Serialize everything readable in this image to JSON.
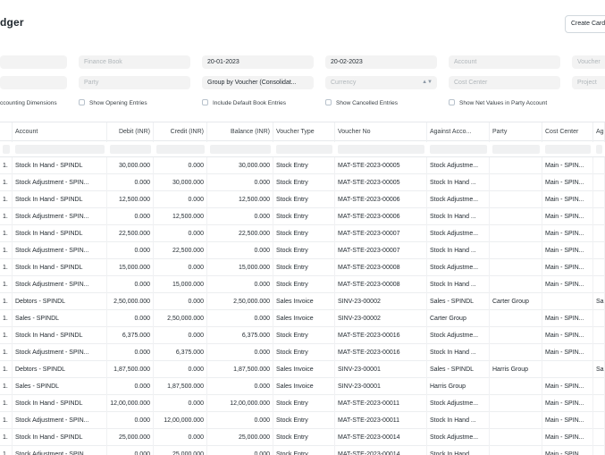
{
  "header": {
    "title": "dger",
    "create_button": "Create Card"
  },
  "filters": {
    "row1": {
      "f0": "",
      "finance_book": "Finance Book",
      "from_date": "20-01-2023",
      "to_date": "20-02-2023",
      "account": "Account",
      "voucher": "Voucher"
    },
    "row2": {
      "f0": "",
      "party": "Party",
      "group_by": "Group by Voucher (Consolidat...",
      "currency": "Currency",
      "cost_center": "Cost Center",
      "project": "Project"
    }
  },
  "checkboxes": {
    "accounting_dimensions": "ccounting Dimensions",
    "opening_entries": "Show Opening Entries",
    "default_book": "Include Default Book Entries",
    "cancelled": "Show Cancelled Entries",
    "net_values": "Show Net Values in Party Account"
  },
  "table": {
    "headers": [
      "",
      "Account",
      "Debit (INR)",
      "Credit (INR)",
      "Balance (INR)",
      "Voucher Type",
      "Voucher No",
      "Against Acco...",
      "Party",
      "Cost Center",
      "Ag"
    ],
    "rows": [
      [
        "1.",
        "Stock In Hand - SPINDL",
        "30,000.000",
        "0.000",
        "30,000.000",
        "Stock Entry",
        "MAT-STE-2023-00005",
        "Stock Adjustme...",
        "",
        "Main - SPIN...",
        ""
      ],
      [
        "1.",
        "Stock Adjustment - SPIN...",
        "0.000",
        "30,000.000",
        "0.000",
        "Stock Entry",
        "MAT-STE-2023-00005",
        "Stock In Hand ...",
        "",
        "Main - SPIN...",
        ""
      ],
      [
        "1.",
        "Stock In Hand - SPINDL",
        "12,500.000",
        "0.000",
        "12,500.000",
        "Stock Entry",
        "MAT-STE-2023-00006",
        "Stock Adjustme...",
        "",
        "Main - SPIN...",
        ""
      ],
      [
        "1.",
        "Stock Adjustment - SPIN...",
        "0.000",
        "12,500.000",
        "0.000",
        "Stock Entry",
        "MAT-STE-2023-00006",
        "Stock In Hand ...",
        "",
        "Main - SPIN...",
        ""
      ],
      [
        "1.",
        "Stock In Hand - SPINDL",
        "22,500.000",
        "0.000",
        "22,500.000",
        "Stock Entry",
        "MAT-STE-2023-00007",
        "Stock Adjustme...",
        "",
        "Main - SPIN...",
        ""
      ],
      [
        "1.",
        "Stock Adjustment - SPIN...",
        "0.000",
        "22,500.000",
        "0.000",
        "Stock Entry",
        "MAT-STE-2023-00007",
        "Stock In Hand ...",
        "",
        "Main - SPIN...",
        ""
      ],
      [
        "1.",
        "Stock In Hand - SPINDL",
        "15,000.000",
        "0.000",
        "15,000.000",
        "Stock Entry",
        "MAT-STE-2023-00008",
        "Stock Adjustme...",
        "",
        "Main - SPIN...",
        ""
      ],
      [
        "1.",
        "Stock Adjustment - SPIN...",
        "0.000",
        "15,000.000",
        "0.000",
        "Stock Entry",
        "MAT-STE-2023-00008",
        "Stock In Hand ...",
        "",
        "Main - SPIN...",
        ""
      ],
      [
        "1.",
        "Debtors - SPINDL",
        "2,50,000.000",
        "0.000",
        "2,50,000.000",
        "Sales Invoice",
        "SINV-23-00002",
        "Sales - SPINDL",
        "Carter Group",
        "",
        "Sa"
      ],
      [
        "1.",
        "Sales - SPINDL",
        "0.000",
        "2,50,000.000",
        "0.000",
        "Sales Invoice",
        "SINV-23-00002",
        "Carter Group",
        "",
        "Main - SPIN...",
        ""
      ],
      [
        "1.",
        "Stock In Hand - SPINDL",
        "6,375.000",
        "0.000",
        "6,375.000",
        "Stock Entry",
        "MAT-STE-2023-00016",
        "Stock Adjustme...",
        "",
        "Main - SPIN...",
        ""
      ],
      [
        "1.",
        "Stock Adjustment - SPIN...",
        "0.000",
        "6,375.000",
        "0.000",
        "Stock Entry",
        "MAT-STE-2023-00016",
        "Stock In Hand ...",
        "",
        "Main - SPIN...",
        ""
      ],
      [
        "1.",
        "Debtors - SPINDL",
        "1,87,500.000",
        "0.000",
        "1,87,500.000",
        "Sales Invoice",
        "SINV-23-00001",
        "Sales - SPINDL",
        "Harris Group",
        "",
        "Sa"
      ],
      [
        "1.",
        "Sales - SPINDL",
        "0.000",
        "1,87,500.000",
        "0.000",
        "Sales Invoice",
        "SINV-23-00001",
        "Harris Group",
        "",
        "Main - SPIN...",
        ""
      ],
      [
        "1.",
        "Stock In Hand - SPINDL",
        "12,00,000.000",
        "0.000",
        "12,00,000.000",
        "Stock Entry",
        "MAT-STE-2023-00011",
        "Stock Adjustme...",
        "",
        "Main - SPIN...",
        ""
      ],
      [
        "1.",
        "Stock Adjustment - SPIN...",
        "0.000",
        "12,00,000.000",
        "0.000",
        "Stock Entry",
        "MAT-STE-2023-00011",
        "Stock In Hand ...",
        "",
        "Main - SPIN...",
        ""
      ],
      [
        "1.",
        "Stock In Hand - SPINDL",
        "25,000.000",
        "0.000",
        "25,000.000",
        "Stock Entry",
        "MAT-STE-2023-00014",
        "Stock Adjustme...",
        "",
        "Main - SPIN...",
        ""
      ],
      [
        "1.",
        "Stock Adjustment - SPIN...",
        "0.000",
        "25,000.000",
        "0.000",
        "Stock Entry",
        "MAT-STE-2023-00014",
        "Stock In Hand ...",
        "",
        "Main - SPIN...",
        ""
      ]
    ]
  }
}
